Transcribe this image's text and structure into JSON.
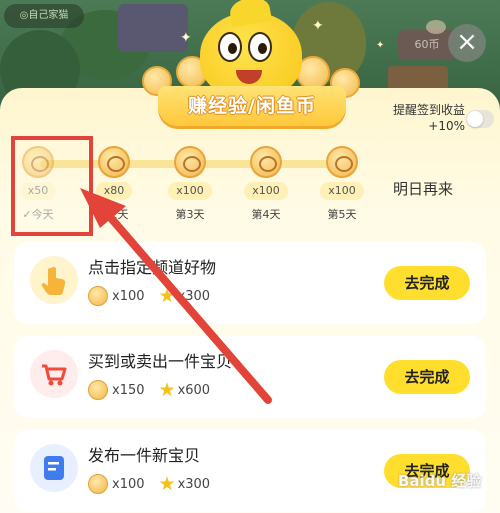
{
  "background": {
    "sign_text": "◎自己家猫",
    "coin_box_text": "60币"
  },
  "close_icon": "close-icon",
  "header": {
    "banner_title": "赚经验/闲鱼币"
  },
  "reminder": {
    "label": "提醒签到收益+10%",
    "enabled": false
  },
  "checkin": {
    "days": [
      {
        "reward": "x50",
        "label": "✓今天",
        "done": true
      },
      {
        "reward": "x80",
        "label": "第2天",
        "done": false
      },
      {
        "reward": "x100",
        "label": "第3天",
        "done": false
      },
      {
        "reward": "x100",
        "label": "第4天",
        "done": false
      },
      {
        "reward": "x100",
        "label": "第5天",
        "done": false
      }
    ],
    "tomorrow_text": "明日再来"
  },
  "tasks": [
    {
      "title": "点击指定频道好物",
      "coins": "x100",
      "exp": "x300",
      "button": "去完成",
      "icon": "hand-pointer-icon"
    },
    {
      "title": "买到或卖出一件宝贝",
      "coins": "x150",
      "exp": "x600",
      "button": "去完成",
      "icon": "shopping-cart-icon"
    },
    {
      "title": "发布一件新宝贝",
      "coins": "x100",
      "exp": "x300",
      "button": "去完成",
      "icon": "edit-document-icon"
    }
  ],
  "watermark": "Baidu 经验",
  "colors": {
    "accent_yellow": "#ffde2e",
    "annotation_red": "#e2443a",
    "panel_bg": "#fffbe6"
  }
}
